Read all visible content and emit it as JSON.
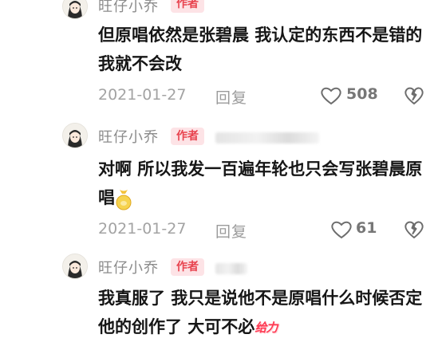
{
  "comments": [
    {
      "username": "旺仔小乔",
      "badge": "作者",
      "text": "但原唱依然是张碧晨 我认定的东西不是错的我就不会改",
      "date": "2021-01-27",
      "reply": "回复",
      "likes": "508"
    },
    {
      "username": "旺仔小乔",
      "badge": "作者",
      "text": "对啊 所以我发一百遍年轮也只会写张碧晨原唱",
      "date": "2021-01-27",
      "reply": "回复",
      "likes": "61"
    },
    {
      "username": "旺仔小乔",
      "badge": "作者",
      "text": "我真服了 我只是说他不是原唱什么时候否定他的创作了 大可不必",
      "sticker_text": "给力"
    }
  ],
  "icons": {
    "like": "heart-outline-icon",
    "dislike": "broken-heart-icon",
    "sticker_1": "gold-coin-bag-sticker",
    "sticker_2": "geili-sticker"
  },
  "colors": {
    "badge_bg": "#fde3e6",
    "badge_text": "#e8434f",
    "meta_text": "#a3a3a3"
  }
}
